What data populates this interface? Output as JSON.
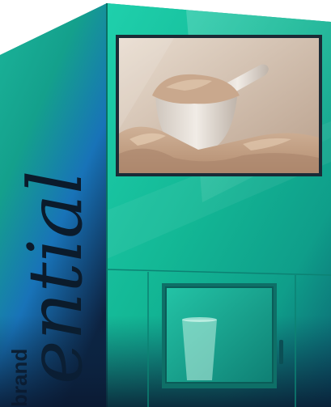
{
  "kiosk": {
    "side_brand_small": "brand",
    "side_brand_word": "ential",
    "screen_scene": "protein-powder-scoop",
    "colors": {
      "teal_light": "#25d3ae",
      "teal_mid": "#12b592",
      "teal_dark": "#0c7d70",
      "blue_accent": "#1d7ad8",
      "navy": "#0d2240",
      "screen_frame": "#1a2b36",
      "powder_light": "#d9c0a3",
      "powder_dark": "#a9836a"
    }
  }
}
